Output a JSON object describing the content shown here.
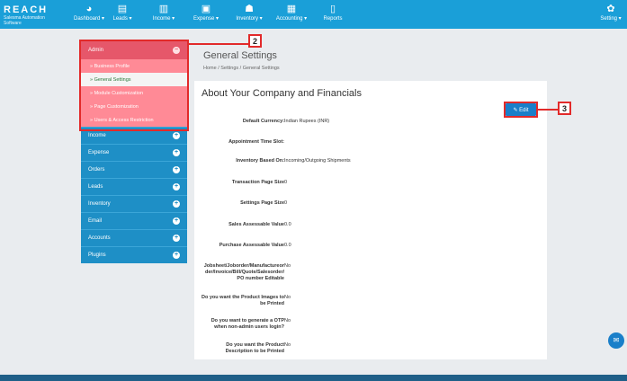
{
  "app": {
    "logo": "REACH",
    "logo_sub": "Salesma Automation Software"
  },
  "nav": [
    {
      "label": "Dashboard ▾",
      "icon": "palette-icon",
      "glyph": "◕"
    },
    {
      "label": "Leads ▾",
      "icon": "monitor-icon",
      "glyph": "▤"
    },
    {
      "label": "Income ▾",
      "icon": "bar-chart-icon",
      "glyph": "▥"
    },
    {
      "label": "Expense ▾",
      "icon": "money-icon",
      "glyph": "▣"
    },
    {
      "label": "Inventory ▾",
      "icon": "cubes-icon",
      "glyph": "☗"
    },
    {
      "label": "Accounting ▾",
      "icon": "calculator-icon",
      "glyph": "▦"
    },
    {
      "label": "Reports",
      "icon": "document-icon",
      "glyph": "▯"
    }
  ],
  "settings_nav": {
    "label": "Setting ▾",
    "glyph": "✿"
  },
  "sidebar": {
    "admin": {
      "label": "Admin",
      "toggle": "−"
    },
    "admin_items": [
      {
        "label": "» Business Profile",
        "active": false
      },
      {
        "label": "» General Settings",
        "active": true
      },
      {
        "label": "» Module Customization",
        "active": false
      },
      {
        "label": "» Page Customization",
        "active": false
      },
      {
        "label": "» Users & Access Restriction",
        "active": false
      }
    ],
    "menus": [
      {
        "label": "Income",
        "toggle": "+"
      },
      {
        "label": "Expense",
        "toggle": "+"
      },
      {
        "label": "Orders",
        "toggle": "+"
      },
      {
        "label": "Leads",
        "toggle": "+"
      },
      {
        "label": "Inventory",
        "toggle": "+"
      },
      {
        "label": "Email",
        "toggle": "+"
      },
      {
        "label": "Accounts",
        "toggle": "+"
      },
      {
        "label": "Plugins",
        "toggle": "+"
      }
    ]
  },
  "callouts": {
    "sidebar": "2",
    "edit": "3"
  },
  "page": {
    "title": "General Settings",
    "breadcrumb": "Home / Settings / General Settings",
    "panel_title": "About Your Company and Financials",
    "edit_label": "✎ Edit"
  },
  "fields": [
    {
      "key": "Default Currency:",
      "value": "Indian Rupees (INR)"
    },
    {
      "key": "Appointment Time Slot:",
      "value": ""
    },
    {
      "key": "Inventory Based On:",
      "value": "Incoming/Outgoing Shipments"
    },
    {
      "key": "Transaction Page Size",
      "value": "0"
    },
    {
      "key": "Settings Page Size",
      "value": "0"
    },
    {
      "key": "Sales Assessable Value",
      "value": "0.0"
    },
    {
      "key": "Purchase Assessable Value",
      "value": "0.0"
    },
    {
      "key": "Jobsheet/Joborder/Manufactureor der/Invoice/Bill/Quote/Salesorder/ PO number Editable",
      "value": "No"
    },
    {
      "key": "Do you want the Product Images to be Printed",
      "value": "No"
    },
    {
      "key": "Do you want to generate a OTP when non-admin users login?",
      "value": "No"
    },
    {
      "key": "Do you want the Product Description to be Printed",
      "value": "No"
    }
  ],
  "chat": {
    "glyph": "✉"
  }
}
